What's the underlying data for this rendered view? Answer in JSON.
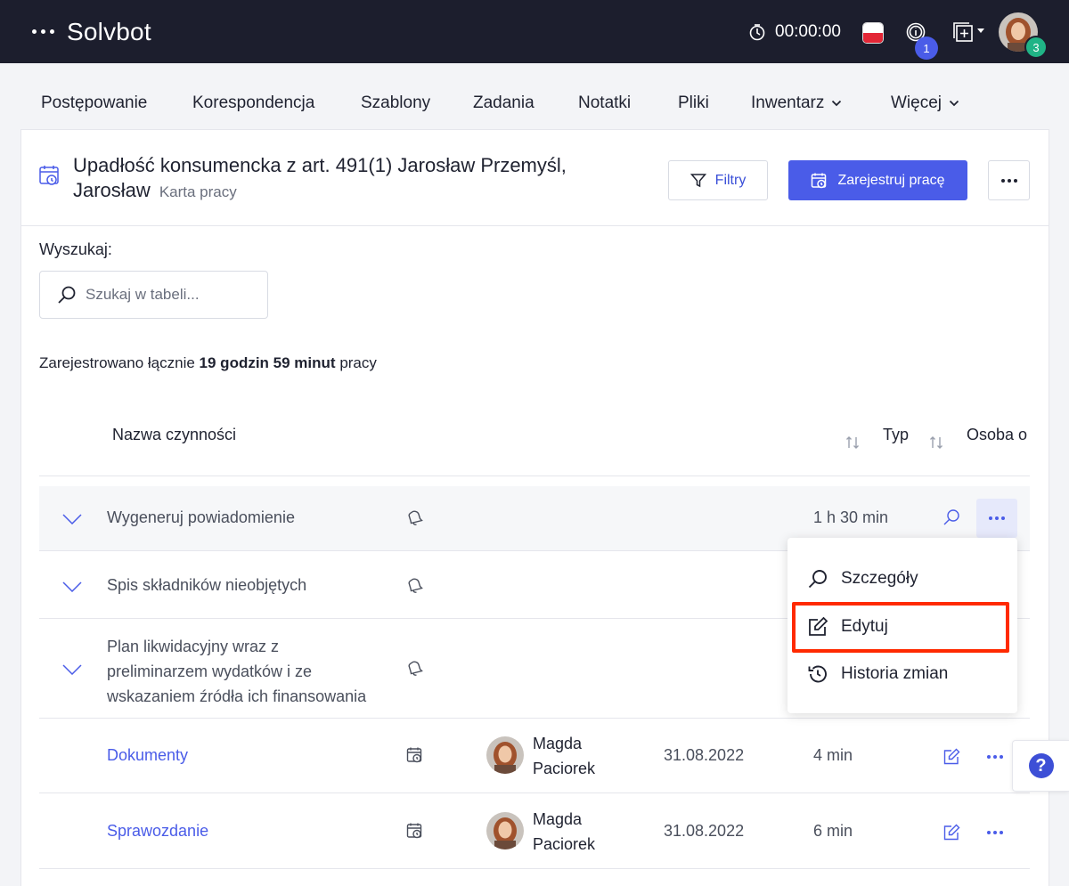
{
  "topbar": {
    "app_title": "Solvbot",
    "timer": "00:00:00",
    "info_badge": "1",
    "user_badge": "3"
  },
  "tabs": [
    {
      "label": "Postępowanie"
    },
    {
      "label": "Korespondencja"
    },
    {
      "label": "Szablony"
    },
    {
      "label": "Zadania"
    },
    {
      "label": "Notatki"
    },
    {
      "label": "Pliki"
    },
    {
      "label": "Inwentarz"
    },
    {
      "label": "Więcej"
    }
  ],
  "header": {
    "title_line1": "Upadłość konsumencka z art. 491(1) Jarosław Przemyśl,",
    "title_line2": "Jarosław",
    "subtitle": "Karta pracy",
    "filter_label": "Filtry",
    "register_label": "Zarejestruj pracę"
  },
  "search": {
    "label": "Wyszukaj:",
    "placeholder": "Szukaj w tabeli...",
    "value": ""
  },
  "summary": {
    "prefix": "Zarejestrowano łącznie",
    "total": "19 godzin 59 minut",
    "suffix": "pracy"
  },
  "table": {
    "columns": [
      "Nazwa czynności",
      "Typ",
      "Osoba o"
    ],
    "groups": [
      {
        "name": "Wygeneruj powiadomienie",
        "duration": "1 h 30 min"
      },
      {
        "name": "Spis składników nieobjętych",
        "duration": ""
      },
      {
        "name_lines": [
          "Plan likwidacyjny wraz z",
          "preliminarzem wydatków i ze",
          "wskazaniem źródła ich finansowania"
        ],
        "duration": ""
      }
    ],
    "entries": [
      {
        "name": "Dokumenty",
        "person_first": "Magda",
        "person_last": "Paciorek",
        "date": "31.08.2022",
        "duration": "4 min"
      },
      {
        "name": "Sprawozdanie",
        "person_first": "Magda",
        "person_last": "Paciorek",
        "date": "31.08.2022",
        "duration": "6 min"
      }
    ]
  },
  "menu": {
    "items": [
      {
        "label": "Szczegóły",
        "icon": "search-icon"
      },
      {
        "label": "Edytuj",
        "icon": "edit-icon"
      },
      {
        "label": "Historia zmian",
        "icon": "history-icon"
      }
    ]
  },
  "help": {
    "label": "?"
  },
  "colors": {
    "topbar": "#1c1e2d",
    "accent": "#4a5ce8",
    "highlight": "#ff2a00",
    "green_badge": "#20b486"
  }
}
